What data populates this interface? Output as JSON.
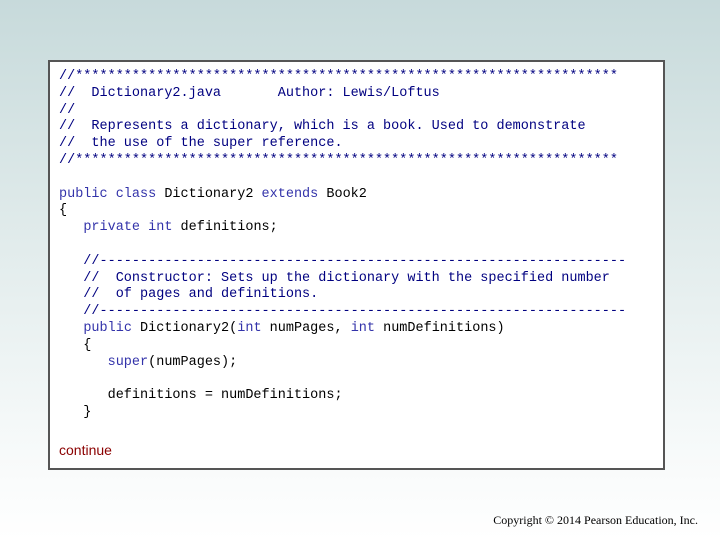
{
  "slide": {
    "code_lines": [
      [
        {
          "t": "//*******************************************************************",
          "c": "cm"
        }
      ],
      [
        {
          "t": "//  Dictionary2.java       Author: Lewis/Loftus",
          "c": "cm"
        }
      ],
      [
        {
          "t": "//",
          "c": "cm"
        }
      ],
      [
        {
          "t": "//  Represents a dictionary, which is a book. Used to demonstrate",
          "c": "cm"
        }
      ],
      [
        {
          "t": "//  the use of the super reference.",
          "c": "cm"
        }
      ],
      [
        {
          "t": "//*******************************************************************",
          "c": "cm"
        }
      ],
      [],
      [
        {
          "t": "public class",
          "c": "kw"
        },
        {
          "t": " Dictionary2 "
        },
        {
          "t": "extends",
          "c": "kw"
        },
        {
          "t": " Book2"
        }
      ],
      [
        {
          "t": "{"
        }
      ],
      [
        {
          "t": "   "
        },
        {
          "t": "private int",
          "c": "kw"
        },
        {
          "t": " definitions;"
        }
      ],
      [],
      [
        {
          "t": "   //-----------------------------------------------------------------",
          "c": "cm"
        }
      ],
      [
        {
          "t": "   //  Constructor: Sets up the dictionary with the specified number",
          "c": "cm"
        }
      ],
      [
        {
          "t": "   //  of pages and definitions.",
          "c": "cm"
        }
      ],
      [
        {
          "t": "   //-----------------------------------------------------------------",
          "c": "cm"
        }
      ],
      [
        {
          "t": "   "
        },
        {
          "t": "public",
          "c": "kw"
        },
        {
          "t": " Dictionary2("
        },
        {
          "t": "int",
          "c": "kw"
        },
        {
          "t": " numPages, "
        },
        {
          "t": "int",
          "c": "kw"
        },
        {
          "t": " numDefinitions)"
        }
      ],
      [
        {
          "t": "   {"
        }
      ],
      [
        {
          "t": "      "
        },
        {
          "t": "super",
          "c": "kw"
        },
        {
          "t": "(numPages);"
        }
      ],
      [],
      [
        {
          "t": "      definitions = numDefinitions;"
        }
      ],
      [
        {
          "t": "   }"
        }
      ]
    ],
    "continue_label": "continue",
    "copyright": "Copyright © 2014 Pearson Education, Inc."
  }
}
